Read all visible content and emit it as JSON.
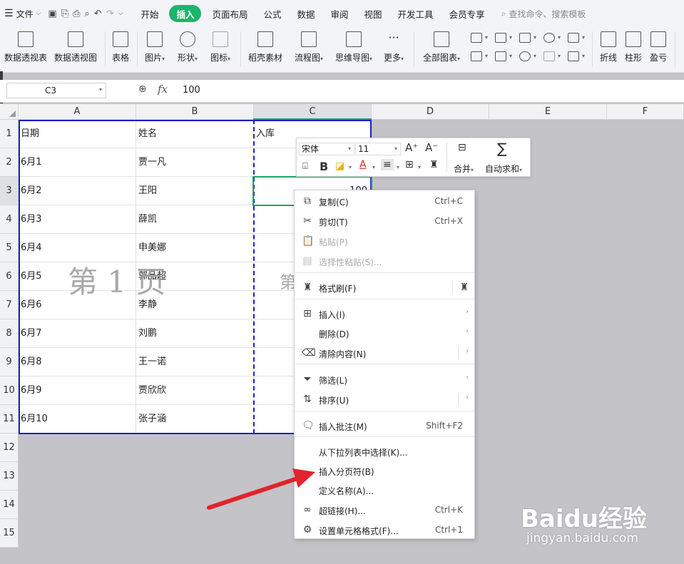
{
  "menubar": {
    "file": "文件",
    "tabs": [
      "开始",
      "插入",
      "页面布局",
      "公式",
      "数据",
      "审阅",
      "视图",
      "开发工具",
      "会员专享"
    ],
    "active_tab_index": 1,
    "search_placeholder": "查找命令、搜索模板"
  },
  "ribbon": {
    "buttons": [
      "数据透视表",
      "数据透视图",
      "表格",
      "图片",
      "形状",
      "图标",
      "稻壳素材",
      "流程图",
      "思维导图",
      "更多",
      "全部图表",
      "折线",
      "柱形",
      "盈亏"
    ]
  },
  "formula_bar": {
    "name_box": "C3",
    "fx": "fx",
    "value": "100"
  },
  "columns": [
    "A",
    "B",
    "C",
    "D",
    "E",
    "F"
  ],
  "selected_column": "C",
  "rows": [
    "1",
    "2",
    "3",
    "4",
    "5",
    "6",
    "7",
    "8",
    "9",
    "10",
    "11",
    "12",
    "13",
    "14",
    "15"
  ],
  "selected_row": "3",
  "table": {
    "A": [
      "日期",
      "6月1",
      "6月2",
      "6月3",
      "6月4",
      "6月5",
      "6月6",
      "6月7",
      "6月8",
      "6月9",
      "6月10"
    ],
    "B": [
      "姓名",
      "贾一凡",
      "王阳",
      "薛凯",
      "申美娜",
      "郭品超",
      "李静",
      "刘鹏",
      "王一诺",
      "贾欣欣",
      "张子涵"
    ],
    "C": [
      "入库",
      "",
      "100",
      "",
      "",
      "",
      "",
      "",
      "",
      "",
      ""
    ]
  },
  "watermarks": {
    "page1": "第 1 页",
    "page2": "第"
  },
  "mini_toolbar": {
    "font": "宋体",
    "size": "11",
    "merge": "合并",
    "autosum": "自动求和"
  },
  "context_menu": {
    "items": [
      {
        "label": "复制(C)",
        "shortcut": "Ctrl+C",
        "icon": "copy-icon",
        "disabled": false
      },
      {
        "label": "剪切(T)",
        "shortcut": "Ctrl+X",
        "icon": "cut-icon",
        "disabled": false
      },
      {
        "label": "粘贴(P)",
        "shortcut": "",
        "icon": "paste-icon",
        "disabled": true
      },
      {
        "label": "选择性粘贴(S)...",
        "shortcut": "",
        "icon": "paste-special-icon",
        "disabled": true
      },
      {
        "label": "格式刷(F)",
        "shortcut": "",
        "icon": "format-painter-icon",
        "disabled": false
      },
      {
        "label": "插入(I)",
        "shortcut": "",
        "icon": "insert-icon",
        "disabled": false
      },
      {
        "label": "删除(D)",
        "shortcut": "",
        "icon": "",
        "disabled": false
      },
      {
        "label": "清除内容(N)",
        "shortcut": "",
        "icon": "eraser-icon",
        "disabled": false
      },
      {
        "label": "筛选(L)",
        "shortcut": "",
        "icon": "filter-icon",
        "disabled": false
      },
      {
        "label": "排序(U)",
        "shortcut": "",
        "icon": "sort-icon",
        "disabled": false
      },
      {
        "label": "插入批注(M)",
        "shortcut": "Shift+F2",
        "icon": "comment-icon",
        "disabled": false
      },
      {
        "label": "从下拉列表中选择(K)...",
        "shortcut": "",
        "icon": "",
        "disabled": false
      },
      {
        "label": "插入分页符(B)",
        "shortcut": "",
        "icon": "",
        "disabled": false
      },
      {
        "label": "定义名称(A)...",
        "shortcut": "",
        "icon": "",
        "disabled": false
      },
      {
        "label": "超链接(H)...",
        "shortcut": "Ctrl+K",
        "icon": "link-icon",
        "disabled": false
      },
      {
        "label": "设置单元格格式(F)...",
        "shortcut": "Ctrl+1",
        "icon": "cell-format-icon",
        "disabled": false
      }
    ]
  },
  "watermark_brand": {
    "logo": "Baidu经验",
    "url": "jingyan.baidu.com"
  },
  "colors": {
    "accent_green": "#1fb46b",
    "page_border": "#1a20c8",
    "arrow_red": "#e0242b"
  }
}
